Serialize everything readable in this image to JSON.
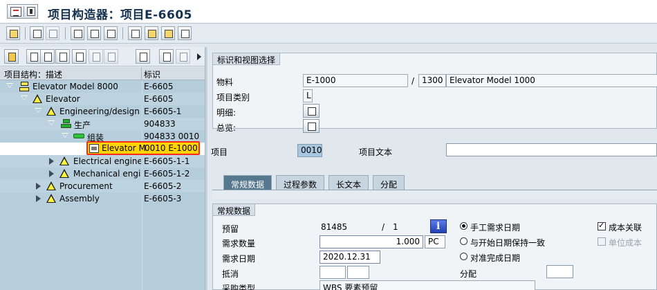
{
  "title": {
    "text": "项目构造器：项目E-6605"
  },
  "tree": {
    "header": {
      "col1": "项目结构：描述",
      "col2": "标识"
    },
    "rows": [
      {
        "text": "Elevator Model 8000",
        "id": "E-6605"
      },
      {
        "text": "Elevator",
        "id": "E-6605"
      },
      {
        "text": "Engineering/design",
        "id": "E-6605-1"
      },
      {
        "text": "生产",
        "id": "904833"
      },
      {
        "text": "组装",
        "id": "904833 0010"
      },
      {
        "text": "Elevator M",
        "id": "0010 E-1000"
      },
      {
        "text": "Electrical engineer",
        "id": "E-6605-1-1"
      },
      {
        "text": "Mechanical engine",
        "id": "E-6605-1-2"
      },
      {
        "text": "Procurement",
        "id": "E-6605-2"
      },
      {
        "text": "Assembly",
        "id": "E-6605-3"
      }
    ]
  },
  "identification": {
    "title": "标识和视图选择",
    "material_label": "物料",
    "material_value": "E-1000",
    "slash": "/",
    "plant_value": "1300",
    "material_desc": "Elevator Model 1000",
    "item_category_label": "项目类别",
    "item_category_value": "L",
    "detail_label": "明细:",
    "overview_label": "总览:"
  },
  "item": {
    "item_label": "项目",
    "item_value": "0010",
    "item_text_label": "项目文本",
    "item_text_value": ""
  },
  "tabs": [
    {
      "label": "常规数据"
    },
    {
      "label": "过程参数"
    },
    {
      "label": "长文本"
    },
    {
      "label": "分配"
    }
  ],
  "general": {
    "title": "常规数据",
    "reservation_label": "预留",
    "reservation_value": "81485",
    "reservation_slash": "/",
    "reservation_item": "1",
    "req_qty_label": "需求数量",
    "req_qty_value": "1.000",
    "req_qty_unit": "PC",
    "req_date_label": "需求日期",
    "req_date_value": "2020.12.31",
    "offset_label": "抵消",
    "purchase_type_label": "采购类型",
    "purchase_type_value": "WBS 要素预留",
    "radio1": "手工需求日期",
    "radio2": "与开始日期保持一致",
    "radio3": "对准完成日期",
    "assign_label": "分配",
    "costing_label": "成本关联",
    "unit_cost_label": "单位成本"
  }
}
